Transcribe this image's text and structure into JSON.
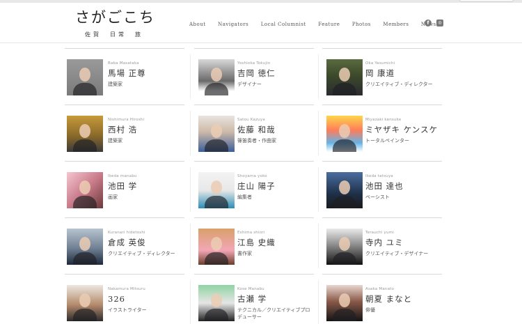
{
  "site": {
    "logo_main": "さがごこち",
    "logo_sub": "佐賀　日常　旅"
  },
  "nav": [
    "About",
    "Navigators",
    "Local Columnist",
    "Feature",
    "Photos",
    "Members",
    "News"
  ],
  "social": [
    {
      "icon": "facebook-icon",
      "glyph": "f"
    },
    {
      "icon": "instagram-icon",
      "glyph": "◎"
    }
  ],
  "members": [
    {
      "roman": "Baba Masataka",
      "name": "馬場 正尊",
      "role": "建築家"
    },
    {
      "roman": "Yoshioka Tokujin",
      "name": "吉岡 徳仁",
      "role": "デザイナー"
    },
    {
      "roman": "Oka Yasumichi",
      "name": "岡 康道",
      "role": "クリエイティブ・ディレクター"
    },
    {
      "roman": "Nishimura Hiroshi",
      "name": "西村 浩",
      "role": "建築家"
    },
    {
      "roman": "Satou Kazuya",
      "name": "佐藤 和哉",
      "role": "篠笛奏者・作曲家"
    },
    {
      "roman": "Miyazaki kensuke",
      "name": "ミヤザキ ケンスケ",
      "role": "トータルペインター"
    },
    {
      "roman": "Ikeda manabu",
      "name": "池田 学",
      "role": "画家"
    },
    {
      "roman": "Shoyama yoko",
      "name": "庄山 陽子",
      "role": "編集者"
    },
    {
      "roman": "Ikeda tatsuya",
      "name": "池田 達也",
      "role": "ベーシスト"
    },
    {
      "roman": "Kuranari hidetoshi",
      "name": "倉成 英俊",
      "role": "クリエイティブ・ディレクター"
    },
    {
      "roman": "Eshima shiori",
      "name": "江島 史織",
      "role": "書作家"
    },
    {
      "roman": "Terauchi yumi",
      "name": "寺内 ユミ",
      "role": "クリエイティブ・デザイナー"
    },
    {
      "roman": "Nakamura Mitsuru",
      "name": "326",
      "role": "イラストライター"
    },
    {
      "roman": "Kose Manabu",
      "name": "古瀬 学",
      "role": "テクニカル／クリエイティブプロデューサー"
    },
    {
      "roman": "Asaka Manato",
      "name": "朝夏 まなと",
      "role": "俳優"
    }
  ]
}
